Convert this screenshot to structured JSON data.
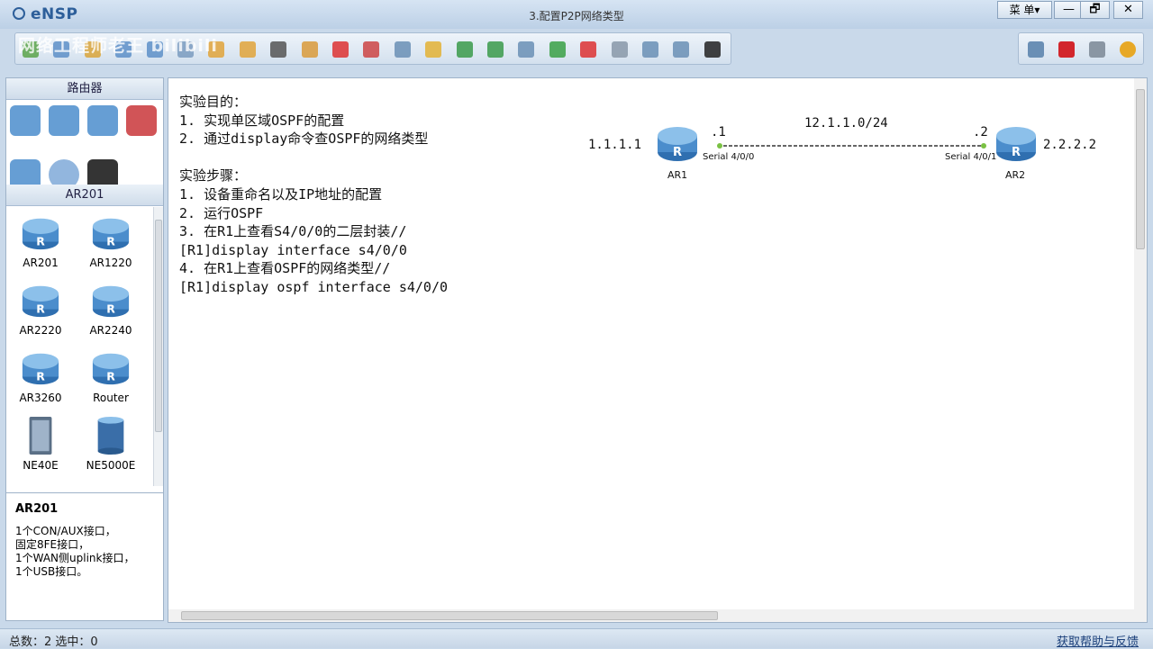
{
  "app": {
    "name": "eNSP",
    "window_title": "3.配置P2P网络类型",
    "menu_label": "菜 单▾",
    "watermark": "网络工程师老王 bilibili"
  },
  "window_controls": {
    "minimize": "—",
    "restore": "🗗",
    "close": "✕"
  },
  "toolbar": {
    "icons": [
      "new-topo-icon",
      "new-icon",
      "open-icon",
      "save-icon",
      "save-as-icon",
      "print-icon",
      "undo-icon",
      "redo-icon",
      "select-icon",
      "pan-icon",
      "delete-icon",
      "delete-link-icon",
      "text-icon",
      "rectangle-icon",
      "zoom-in-icon",
      "zoom-out-icon",
      "fit-icon",
      "start-icon",
      "stop-icon",
      "capture-icon",
      "topology-icon",
      "grid-icon",
      "terminal-icon"
    ]
  },
  "toolbar_right": {
    "icons": [
      "chat-icon",
      "huawei-icon",
      "settings-icon",
      "help-icon"
    ]
  },
  "left_panel": {
    "category_title": "路由器",
    "categories": [
      "router-category-icon",
      "switch-category-icon",
      "wireless-category-icon",
      "firewall-category-icon",
      "pc-category-icon",
      "cloud-category-icon",
      "cable-category-icon"
    ],
    "series_title": "AR201",
    "devices": [
      {
        "name": "AR201",
        "icon": "router-icon"
      },
      {
        "name": "AR1220",
        "icon": "router-icon"
      },
      {
        "name": "AR2220",
        "icon": "router-icon"
      },
      {
        "name": "AR2240",
        "icon": "router-icon"
      },
      {
        "name": "AR3260",
        "icon": "router-icon"
      },
      {
        "name": "Router",
        "icon": "router-icon"
      },
      {
        "name": "NE40E",
        "icon": "chassis-icon"
      },
      {
        "name": "NE5000E",
        "icon": "chassis-round-icon"
      }
    ],
    "description": {
      "title": "AR201",
      "lines": [
        "1个CON/AUX接口，",
        "固定8FE接口，",
        "1个WAN侧uplink接口，",
        "1个USB接口。"
      ]
    }
  },
  "canvas": {
    "notes": [
      "实验目的：",
      "1. 实现单区域OSPF的配置",
      "2. 通过display命令查OSPF的网络类型",
      "",
      "实验步骤：",
      "1. 设备重命名以及IP地址的配置",
      "2. 运行OSPF",
      "3. 在R1上查看S4/0/0的二层封装//",
      "[R1]display interface s4/0/0",
      "4. 在R1上查看OSPF的网络类型//",
      "[R1]display ospf interface s4/0/0"
    ],
    "topology": {
      "network": "12.1.1.0/24",
      "r1": {
        "name": "AR1",
        "loopback": "1.1.1.1",
        "host_id": ".1",
        "interface": "Serial 4/0/0"
      },
      "r2": {
        "name": "AR2",
        "loopback": "2.2.2.2",
        "host_id": ".2",
        "interface": "Serial 4/0/1"
      },
      "link_color": "#333333",
      "port_color": "#7ac143"
    }
  },
  "status": {
    "text": "总数：2 选中：0",
    "help_link": "获取帮助与反馈"
  }
}
